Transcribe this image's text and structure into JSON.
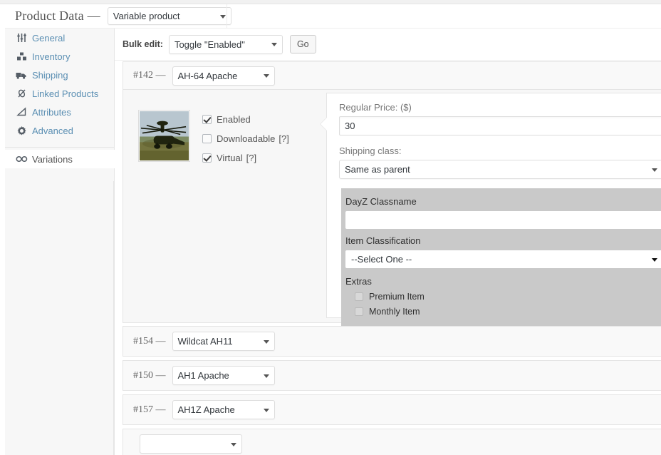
{
  "header": {
    "title": "Product Data —",
    "product_type": "Variable product",
    "caret_icon": "chevron-down-icon"
  },
  "tabs": [
    {
      "label": "General",
      "icon": "sliders-icon",
      "active": false
    },
    {
      "label": "Inventory",
      "icon": "boxes-icon",
      "active": false
    },
    {
      "label": "Shipping",
      "icon": "truck-icon",
      "active": false
    },
    {
      "label": "Linked Products",
      "icon": "link-icon",
      "active": false
    },
    {
      "label": "Attributes",
      "icon": "triangle-icon",
      "active": false
    },
    {
      "label": "Advanced",
      "icon": "gear-icon",
      "active": false
    },
    {
      "label": "Variations",
      "icon": "infinity-icon",
      "active": true
    }
  ],
  "bulk": {
    "label": "Bulk edit:",
    "selected": "Toggle \"Enabled\"",
    "go_label": "Go"
  },
  "variations": [
    {
      "id": "#142 —",
      "attribute": "AH-64 Apache",
      "expanded": true,
      "thumbnail_alt": "AH-64 Apache helicopter photo",
      "checkboxes": [
        {
          "label": "Enabled",
          "hint": "",
          "checked": true
        },
        {
          "label": "Downloadable",
          "hint": "[?]",
          "checked": false
        },
        {
          "label": "Virtual",
          "hint": "[?]",
          "checked": true
        }
      ],
      "fields": {
        "regular_price_label": "Regular Price: ($)",
        "regular_price_value": "30",
        "shipping_class_label": "Shipping class:",
        "shipping_class_value": "Same as parent"
      },
      "plugin": {
        "classname_label": "DayZ Classname",
        "classname_value": "",
        "classification_label": "Item Classification",
        "classification_value": "--Select One --",
        "extras_label": "Extras",
        "extras": [
          {
            "label": "Premium Item",
            "checked": false
          },
          {
            "label": "Monthly Item",
            "checked": false
          }
        ]
      }
    },
    {
      "id": "#154 —",
      "attribute": "Wildcat AH11",
      "expanded": false
    },
    {
      "id": "#150 —",
      "attribute": "AH1 Apache",
      "expanded": false
    },
    {
      "id": "#157 —",
      "attribute": "AH1Z Apache",
      "expanded": false
    },
    {
      "id": "",
      "attribute": "",
      "expanded": false
    }
  ],
  "colors": {
    "link": "#5b8fb3",
    "panel_bg": "#f7f7f7",
    "plugin_bg": "#c9c9c9",
    "border": "#e5e5e5"
  }
}
